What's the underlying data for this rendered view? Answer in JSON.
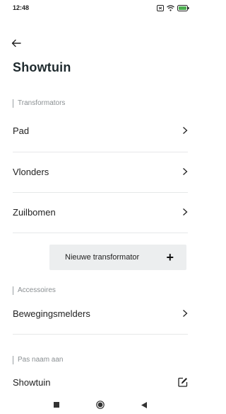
{
  "status_bar": {
    "time": "12:48"
  },
  "page": {
    "title": "Showtuin"
  },
  "sections": {
    "transformators": {
      "label": "Transformators",
      "items": [
        {
          "label": "Pad"
        },
        {
          "label": "Vlonders"
        },
        {
          "label": "Zuilbomen"
        }
      ],
      "new_button_label": "Nieuwe transformator",
      "new_button_icon": "+"
    },
    "accessoires": {
      "label": "Accessoires",
      "items": [
        {
          "label": "Bewegingsmelders"
        }
      ]
    },
    "rename": {
      "label": "Pas naam aan",
      "value": "Showtuin"
    }
  },
  "icons": {
    "back": "back-arrow-icon",
    "chevron": "chevron-right-icon",
    "edit": "edit-icon",
    "plus": "plus-icon"
  }
}
